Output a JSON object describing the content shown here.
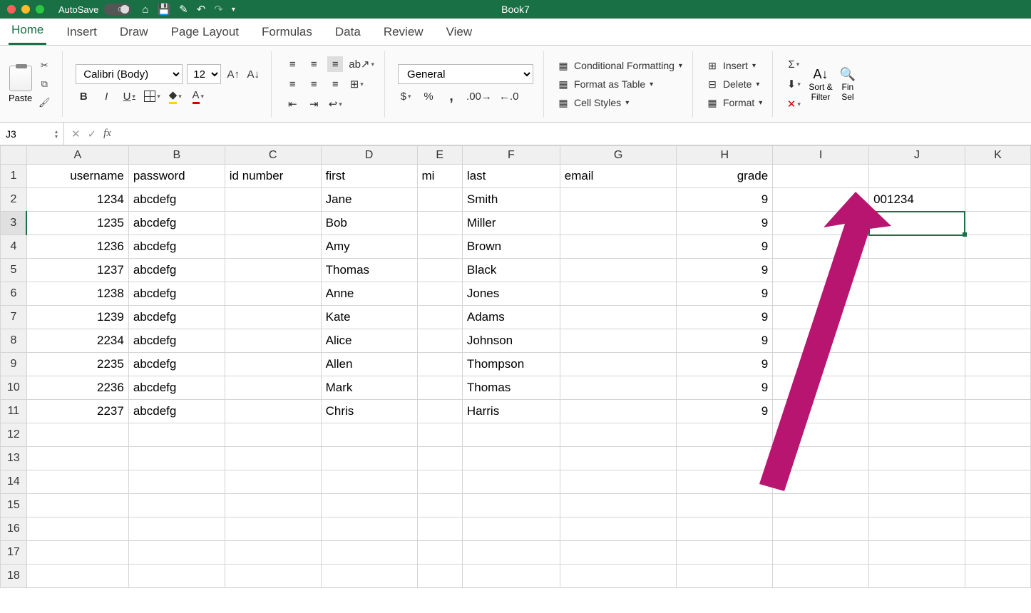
{
  "titlebar": {
    "autosave": "AutoSave",
    "off": "OFF",
    "title": "Book7"
  },
  "menu": {
    "tabs": [
      "Home",
      "Insert",
      "Draw",
      "Page Layout",
      "Formulas",
      "Data",
      "Review",
      "View"
    ],
    "active": 0
  },
  "ribbon": {
    "paste": "Paste",
    "font": "Calibri (Body)",
    "size": "12",
    "bold": "B",
    "italic": "I",
    "underline": "U",
    "numfmt": "General",
    "dollar": "$",
    "percent": "%",
    "comma": ",",
    "cond": "Conditional Formatting",
    "fmttable": "Format as Table",
    "cellstyles": "Cell Styles",
    "insert": "Insert",
    "delete": "Delete",
    "format": "Format",
    "sortfilter": "Sort &\nFilter",
    "findsel": "Fin\nSel"
  },
  "namebox": "J3",
  "formula": "",
  "columns": [
    "A",
    "B",
    "C",
    "D",
    "E",
    "F",
    "G",
    "H",
    "I",
    "J",
    "K"
  ],
  "headers": {
    "A": "username",
    "B": "password",
    "C": "id number",
    "D": "first",
    "E": "mi",
    "F": "last",
    "G": "email",
    "H": "grade"
  },
  "rows": [
    {
      "A": "1234",
      "B": "abcdefg",
      "D": "Jane",
      "F": "Smith",
      "H": "9",
      "J": "001234"
    },
    {
      "A": "1235",
      "B": "abcdefg",
      "D": "Bob",
      "F": "Miller",
      "H": "9"
    },
    {
      "A": "1236",
      "B": "abcdefg",
      "D": "Amy",
      "F": "Brown",
      "H": "9"
    },
    {
      "A": "1237",
      "B": "abcdefg",
      "D": "Thomas",
      "F": "Black",
      "H": "9"
    },
    {
      "A": "1238",
      "B": "abcdefg",
      "D": "Anne",
      "F": "Jones",
      "H": "9"
    },
    {
      "A": "1239",
      "B": "abcdefg",
      "D": "Kate",
      "F": "Adams",
      "H": "9"
    },
    {
      "A": "2234",
      "B": "abcdefg",
      "D": "Alice",
      "F": "Johnson",
      "H": "9"
    },
    {
      "A": "2235",
      "B": "abcdefg",
      "D": "Allen",
      "F": "Thompson",
      "H": "9"
    },
    {
      "A": "2236",
      "B": "abcdefg",
      "D": "Mark",
      "F": "Thomas",
      "H": "9"
    },
    {
      "A": "2237",
      "B": "abcdefg",
      "D": "Chris",
      "F": "Harris",
      "H": "9"
    }
  ],
  "totalRows": 18,
  "activeCell": "J3",
  "selectedRow": 3
}
